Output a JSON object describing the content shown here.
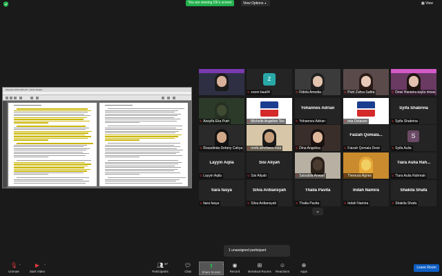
{
  "top_bar": {
    "sharing_status": "You are viewing DE's screen",
    "view_options": "View Options",
    "view_label": "View"
  },
  "shared_screen": {
    "window_title": "Panduan-KKN-2022.pdf - Adobe Reader"
  },
  "participants": [
    {
      "id": "host",
      "name": "",
      "display": "video",
      "active": true
    },
    {
      "id": "zoom",
      "name": "zoom baa04",
      "display": "initial",
      "initial": "z"
    },
    {
      "id": "fidela",
      "name": "Fidela Amodia",
      "display": "video"
    },
    {
      "id": "putri",
      "name": "Putri Zahra Safira",
      "display": "video"
    },
    {
      "id": "dewi",
      "name": "Dewi Hanisha kayla nirwana",
      "display": "video"
    },
    {
      "id": "assyifa",
      "name": "Assyifa Eka Putri",
      "display": "video"
    },
    {
      "id": "michelle",
      "name": "Michelle Angeline Teo",
      "display": "video"
    },
    {
      "id": "yohannes",
      "name": "Yohannes Adrian",
      "display": "name"
    },
    {
      "id": "mia",
      "name": "mia Octarani",
      "display": "video"
    },
    {
      "id": "syifa",
      "name": "Syifa Shabrina",
      "display": "name"
    },
    {
      "id": "rosadinda",
      "name": "Rosadinda Defany Cahya",
      "display": "video"
    },
    {
      "id": "revfa",
      "name": "revfa amriliana rosa",
      "display": "video"
    },
    {
      "id": "dina",
      "name": "Dina Angelica",
      "display": "video"
    },
    {
      "id": "faizah",
      "name": "Faizah Qomala Dewi",
      "display": "name",
      "big_name": "Faizah Qomala..."
    },
    {
      "id": "syifaaulia",
      "name": "Syifa Aulia",
      "display": "initial",
      "initial": "S"
    },
    {
      "id": "layyin",
      "name": "Layyin Aqila",
      "display": "name"
    },
    {
      "id": "sisi",
      "name": "Sisi Aliyah",
      "display": "name"
    },
    {
      "id": "salsabila",
      "name": "Salsabila Anwari",
      "display": "video"
    },
    {
      "id": "therezia",
      "name": "Therezia Agnes",
      "display": "video"
    },
    {
      "id": "tiara",
      "name": "Tiara Aulia Rahmah",
      "display": "name",
      "big_name": "Tiara Aulia Rah..."
    },
    {
      "id": "tiarafasya",
      "name": "tiara fasya",
      "display": "name"
    },
    {
      "id": "silva",
      "name": "Silva Ardiansyah",
      "display": "name"
    },
    {
      "id": "thalia",
      "name": "Thalia Pavita",
      "display": "name"
    },
    {
      "id": "indah",
      "name": "Indah Namira",
      "display": "name"
    },
    {
      "id": "shakila",
      "name": "Shakila Shafa",
      "display": "name"
    }
  ],
  "gallery_more_icon": "chevron-down-icon",
  "unassigned_notice": "1 unassigned participant",
  "toolbar": {
    "unmute": "Unmute",
    "start_video": "Start Video",
    "participants": "Participants",
    "participants_count": "37",
    "chat": "Chat",
    "share_screen": "Share Screen",
    "record": "Record",
    "breakout_rooms": "Breakout Rooms",
    "reactions": "Reactions",
    "apps": "Apps",
    "leave_room": "Leave Room"
  },
  "colors": {
    "sharing_green": "#23b14d",
    "leave_blue": "#0e5fc4",
    "active_speaker": "#f5c400",
    "muted_red": "#e0383e"
  }
}
